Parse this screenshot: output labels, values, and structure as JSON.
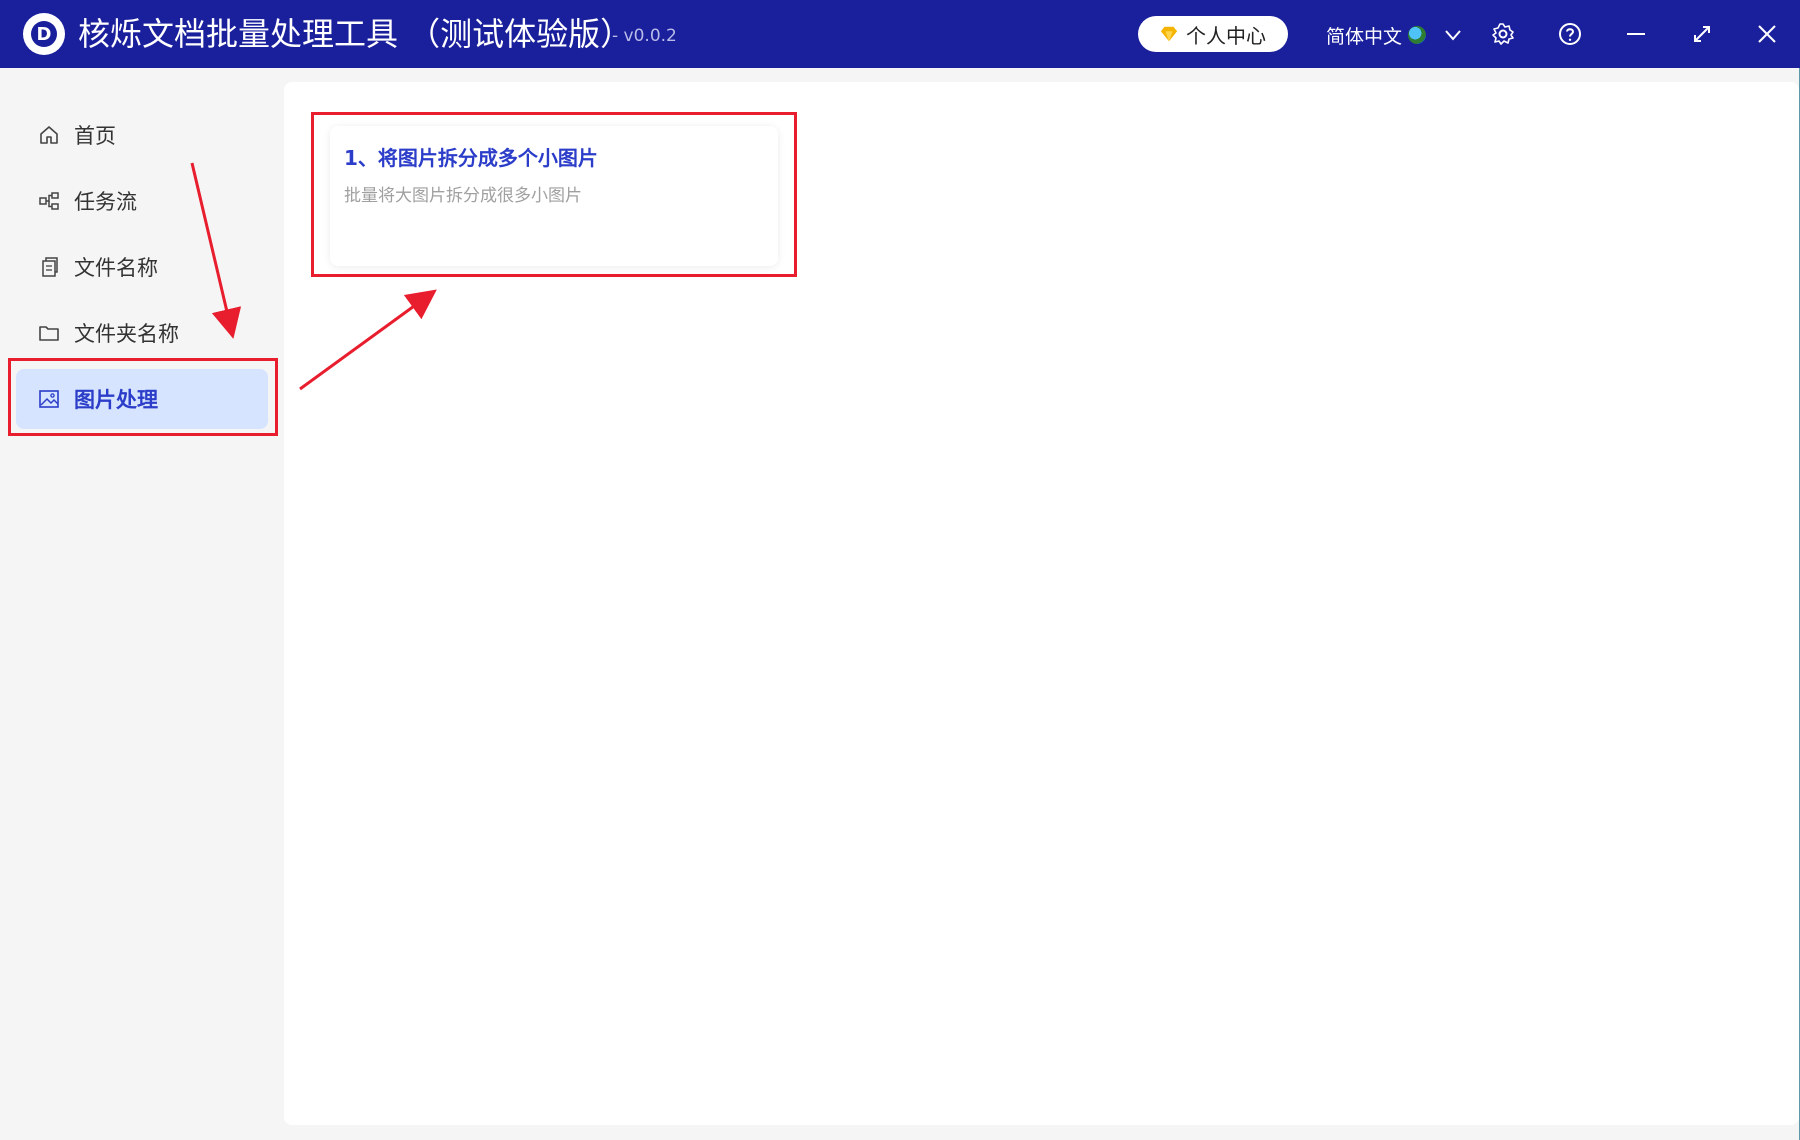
{
  "window": {
    "title": "核烁文档批量处理工具 （测试体验版）",
    "version": "- v0.0.2",
    "logo_letter": "D",
    "user_center_label": "个人中心",
    "language_label": "简体中文",
    "icons": [
      "diamond-icon",
      "globe-icon",
      "chevron-down-icon",
      "gear-icon",
      "help-icon",
      "minimize-icon",
      "maximize-icon",
      "close-icon"
    ]
  },
  "sidebar": {
    "items": [
      {
        "label": "首页",
        "icon": "home-icon",
        "active": false
      },
      {
        "label": "任务流",
        "icon": "workflow-icon",
        "active": false
      },
      {
        "label": "文件名称",
        "icon": "file-icon",
        "active": false
      },
      {
        "label": "文件夹名称",
        "icon": "folder-icon",
        "active": false
      },
      {
        "label": "图片处理",
        "icon": "image-icon",
        "active": true
      }
    ]
  },
  "main": {
    "cards": [
      {
        "title": "1、将图片拆分成多个小图片",
        "description": "批量将大图片拆分成很多小图片"
      }
    ]
  },
  "colors": {
    "titlebar": "#1a1f9c",
    "accent": "#2b3dc9",
    "active_bg": "#d6e4ff",
    "annotation": "#e81d2d"
  }
}
